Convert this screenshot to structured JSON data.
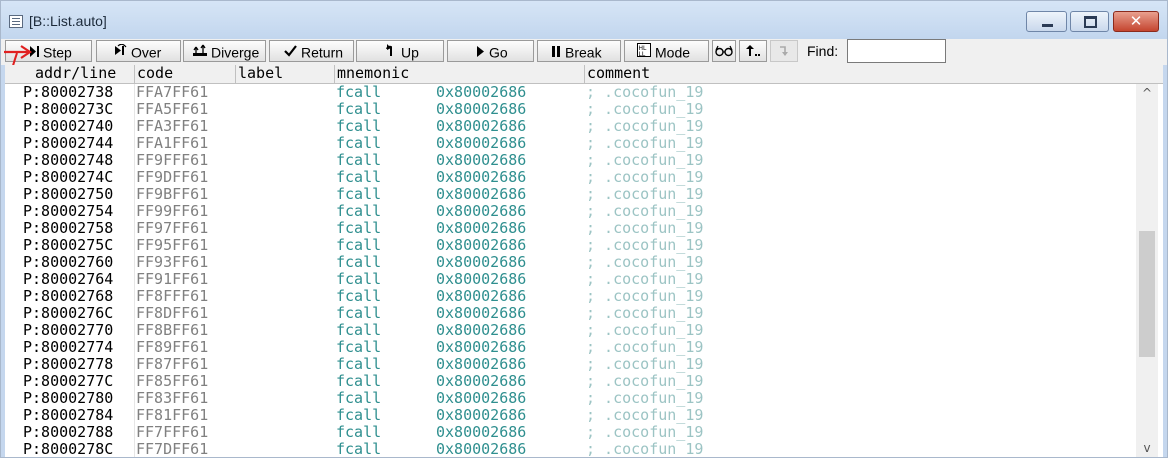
{
  "window": {
    "title": "[B::List.auto]"
  },
  "toolbar": {
    "step": "Step",
    "over": "Over",
    "diverge": "Diverge",
    "return": "Return",
    "up": "Up",
    "go": "Go",
    "break": "Break",
    "mode": "Mode",
    "find_label": "Find:",
    "find_value": ""
  },
  "columns": {
    "addr": "addr/line",
    "code": "code",
    "label": "label",
    "mnemonic": "mnemonic",
    "comment": "comment"
  },
  "rows": [
    {
      "addr": "P:80002738",
      "code": "FFA7FF61",
      "mnemonic": "fcall",
      "operand": "0x80002686",
      "comment": "; .cocofun_19"
    },
    {
      "addr": "P:8000273C",
      "code": "FFA5FF61",
      "mnemonic": "fcall",
      "operand": "0x80002686",
      "comment": "; .cocofun_19"
    },
    {
      "addr": "P:80002740",
      "code": "FFA3FF61",
      "mnemonic": "fcall",
      "operand": "0x80002686",
      "comment": "; .cocofun_19"
    },
    {
      "addr": "P:80002744",
      "code": "FFA1FF61",
      "mnemonic": "fcall",
      "operand": "0x80002686",
      "comment": "; .cocofun_19"
    },
    {
      "addr": "P:80002748",
      "code": "FF9FFF61",
      "mnemonic": "fcall",
      "operand": "0x80002686",
      "comment": "; .cocofun_19"
    },
    {
      "addr": "P:8000274C",
      "code": "FF9DFF61",
      "mnemonic": "fcall",
      "operand": "0x80002686",
      "comment": "; .cocofun_19"
    },
    {
      "addr": "P:80002750",
      "code": "FF9BFF61",
      "mnemonic": "fcall",
      "operand": "0x80002686",
      "comment": "; .cocofun_19"
    },
    {
      "addr": "P:80002754",
      "code": "FF99FF61",
      "mnemonic": "fcall",
      "operand": "0x80002686",
      "comment": "; .cocofun_19"
    },
    {
      "addr": "P:80002758",
      "code": "FF97FF61",
      "mnemonic": "fcall",
      "operand": "0x80002686",
      "comment": "; .cocofun_19"
    },
    {
      "addr": "P:8000275C",
      "code": "FF95FF61",
      "mnemonic": "fcall",
      "operand": "0x80002686",
      "comment": "; .cocofun_19"
    },
    {
      "addr": "P:80002760",
      "code": "FF93FF61",
      "mnemonic": "fcall",
      "operand": "0x80002686",
      "comment": "; .cocofun_19"
    },
    {
      "addr": "P:80002764",
      "code": "FF91FF61",
      "mnemonic": "fcall",
      "operand": "0x80002686",
      "comment": "; .cocofun_19"
    },
    {
      "addr": "P:80002768",
      "code": "FF8FFF61",
      "mnemonic": "fcall",
      "operand": "0x80002686",
      "comment": "; .cocofun_19"
    },
    {
      "addr": "P:8000276C",
      "code": "FF8DFF61",
      "mnemonic": "fcall",
      "operand": "0x80002686",
      "comment": "; .cocofun_19"
    },
    {
      "addr": "P:80002770",
      "code": "FF8BFF61",
      "mnemonic": "fcall",
      "operand": "0x80002686",
      "comment": "; .cocofun_19"
    },
    {
      "addr": "P:80002774",
      "code": "FF89FF61",
      "mnemonic": "fcall",
      "operand": "0x80002686",
      "comment": "; .cocofun_19"
    },
    {
      "addr": "P:80002778",
      "code": "FF87FF61",
      "mnemonic": "fcall",
      "operand": "0x80002686",
      "comment": "; .cocofun_19"
    },
    {
      "addr": "P:8000277C",
      "code": "FF85FF61",
      "mnemonic": "fcall",
      "operand": "0x80002686",
      "comment": "; .cocofun_19"
    },
    {
      "addr": "P:80002780",
      "code": "FF83FF61",
      "mnemonic": "fcall",
      "operand": "0x80002686",
      "comment": "; .cocofun_19"
    },
    {
      "addr": "P:80002784",
      "code": "FF81FF61",
      "mnemonic": "fcall",
      "operand": "0x80002686",
      "comment": "; .cocofun_19"
    },
    {
      "addr": "P:80002788",
      "code": "FF7FFF61",
      "mnemonic": "fcall",
      "operand": "0x80002686",
      "comment": "; .cocofun_19"
    },
    {
      "addr": "P:8000278C",
      "code": "FF7DFF61",
      "mnemonic": "fcall",
      "operand": "0x80002686",
      "comment": "; .cocofun_19"
    }
  ],
  "icons": {
    "window": "list-window-icon",
    "step": "step-icon",
    "over": "step-over-icon",
    "diverge": "diverge-icon",
    "return": "return-icon",
    "up": "up-icon",
    "go": "play-icon",
    "break": "pause-icon",
    "mode": "mode-icon",
    "eye": "glasses-icon",
    "up2": "up-arrow-icon",
    "disabled": "undo-icon",
    "annotation": "red-arrow-annotation"
  },
  "colors": {
    "mnemonic": "#2f8f8f",
    "comment": "#9cc4c4",
    "code": "#808080",
    "close": "#c4452f"
  }
}
